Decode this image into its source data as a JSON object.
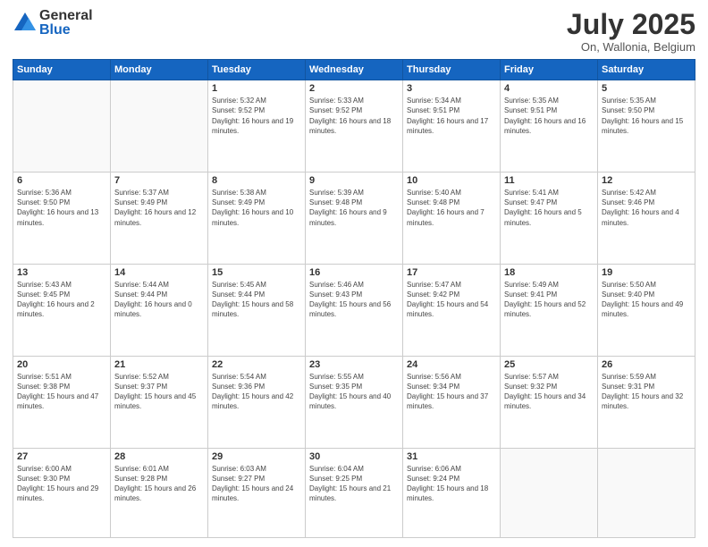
{
  "logo": {
    "general": "General",
    "blue": "Blue"
  },
  "header": {
    "month": "July 2025",
    "location": "On, Wallonia, Belgium"
  },
  "days_of_week": [
    "Sunday",
    "Monday",
    "Tuesday",
    "Wednesday",
    "Thursday",
    "Friday",
    "Saturday"
  ],
  "weeks": [
    [
      {
        "day": "",
        "info": ""
      },
      {
        "day": "",
        "info": ""
      },
      {
        "day": "1",
        "info": "Sunrise: 5:32 AM\nSunset: 9:52 PM\nDaylight: 16 hours and 19 minutes."
      },
      {
        "day": "2",
        "info": "Sunrise: 5:33 AM\nSunset: 9:52 PM\nDaylight: 16 hours and 18 minutes."
      },
      {
        "day": "3",
        "info": "Sunrise: 5:34 AM\nSunset: 9:51 PM\nDaylight: 16 hours and 17 minutes."
      },
      {
        "day": "4",
        "info": "Sunrise: 5:35 AM\nSunset: 9:51 PM\nDaylight: 16 hours and 16 minutes."
      },
      {
        "day": "5",
        "info": "Sunrise: 5:35 AM\nSunset: 9:50 PM\nDaylight: 16 hours and 15 minutes."
      }
    ],
    [
      {
        "day": "6",
        "info": "Sunrise: 5:36 AM\nSunset: 9:50 PM\nDaylight: 16 hours and 13 minutes."
      },
      {
        "day": "7",
        "info": "Sunrise: 5:37 AM\nSunset: 9:49 PM\nDaylight: 16 hours and 12 minutes."
      },
      {
        "day": "8",
        "info": "Sunrise: 5:38 AM\nSunset: 9:49 PM\nDaylight: 16 hours and 10 minutes."
      },
      {
        "day": "9",
        "info": "Sunrise: 5:39 AM\nSunset: 9:48 PM\nDaylight: 16 hours and 9 minutes."
      },
      {
        "day": "10",
        "info": "Sunrise: 5:40 AM\nSunset: 9:48 PM\nDaylight: 16 hours and 7 minutes."
      },
      {
        "day": "11",
        "info": "Sunrise: 5:41 AM\nSunset: 9:47 PM\nDaylight: 16 hours and 5 minutes."
      },
      {
        "day": "12",
        "info": "Sunrise: 5:42 AM\nSunset: 9:46 PM\nDaylight: 16 hours and 4 minutes."
      }
    ],
    [
      {
        "day": "13",
        "info": "Sunrise: 5:43 AM\nSunset: 9:45 PM\nDaylight: 16 hours and 2 minutes."
      },
      {
        "day": "14",
        "info": "Sunrise: 5:44 AM\nSunset: 9:44 PM\nDaylight: 16 hours and 0 minutes."
      },
      {
        "day": "15",
        "info": "Sunrise: 5:45 AM\nSunset: 9:44 PM\nDaylight: 15 hours and 58 minutes."
      },
      {
        "day": "16",
        "info": "Sunrise: 5:46 AM\nSunset: 9:43 PM\nDaylight: 15 hours and 56 minutes."
      },
      {
        "day": "17",
        "info": "Sunrise: 5:47 AM\nSunset: 9:42 PM\nDaylight: 15 hours and 54 minutes."
      },
      {
        "day": "18",
        "info": "Sunrise: 5:49 AM\nSunset: 9:41 PM\nDaylight: 15 hours and 52 minutes."
      },
      {
        "day": "19",
        "info": "Sunrise: 5:50 AM\nSunset: 9:40 PM\nDaylight: 15 hours and 49 minutes."
      }
    ],
    [
      {
        "day": "20",
        "info": "Sunrise: 5:51 AM\nSunset: 9:38 PM\nDaylight: 15 hours and 47 minutes."
      },
      {
        "day": "21",
        "info": "Sunrise: 5:52 AM\nSunset: 9:37 PM\nDaylight: 15 hours and 45 minutes."
      },
      {
        "day": "22",
        "info": "Sunrise: 5:54 AM\nSunset: 9:36 PM\nDaylight: 15 hours and 42 minutes."
      },
      {
        "day": "23",
        "info": "Sunrise: 5:55 AM\nSunset: 9:35 PM\nDaylight: 15 hours and 40 minutes."
      },
      {
        "day": "24",
        "info": "Sunrise: 5:56 AM\nSunset: 9:34 PM\nDaylight: 15 hours and 37 minutes."
      },
      {
        "day": "25",
        "info": "Sunrise: 5:57 AM\nSunset: 9:32 PM\nDaylight: 15 hours and 34 minutes."
      },
      {
        "day": "26",
        "info": "Sunrise: 5:59 AM\nSunset: 9:31 PM\nDaylight: 15 hours and 32 minutes."
      }
    ],
    [
      {
        "day": "27",
        "info": "Sunrise: 6:00 AM\nSunset: 9:30 PM\nDaylight: 15 hours and 29 minutes."
      },
      {
        "day": "28",
        "info": "Sunrise: 6:01 AM\nSunset: 9:28 PM\nDaylight: 15 hours and 26 minutes."
      },
      {
        "day": "29",
        "info": "Sunrise: 6:03 AM\nSunset: 9:27 PM\nDaylight: 15 hours and 24 minutes."
      },
      {
        "day": "30",
        "info": "Sunrise: 6:04 AM\nSunset: 9:25 PM\nDaylight: 15 hours and 21 minutes."
      },
      {
        "day": "31",
        "info": "Sunrise: 6:06 AM\nSunset: 9:24 PM\nDaylight: 15 hours and 18 minutes."
      },
      {
        "day": "",
        "info": ""
      },
      {
        "day": "",
        "info": ""
      }
    ]
  ]
}
